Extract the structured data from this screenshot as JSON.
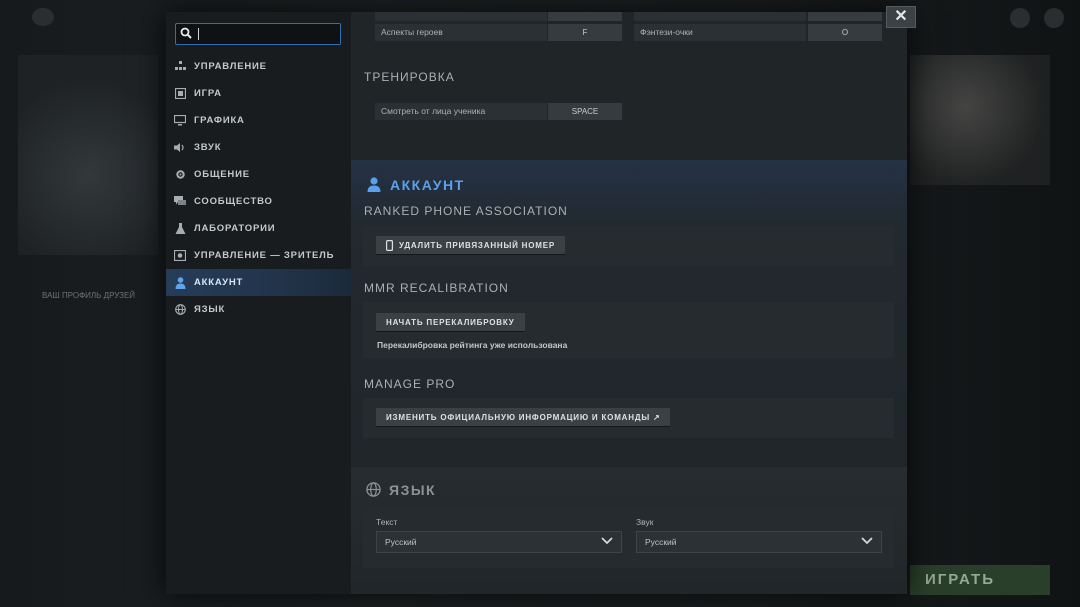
{
  "close_label": "✕",
  "background": {
    "play_label": "ИГРАТЬ",
    "caption": "ВАШ ПРОФИЛЬ ДРУЗЕЙ"
  },
  "sidebar": {
    "search": {
      "value": "",
      "placeholder": ""
    },
    "items": [
      {
        "label": "УПРАВЛЕНИЕ",
        "icon": "grid-icon"
      },
      {
        "label": "ИГРА",
        "icon": "game-icon"
      },
      {
        "label": "ГРАФИКА",
        "icon": "monitor-icon"
      },
      {
        "label": "ЗВУК",
        "icon": "speaker-icon"
      },
      {
        "label": "ОБЩЕНИЕ",
        "icon": "gear-icon"
      },
      {
        "label": "СООБЩЕСТВО",
        "icon": "chat-icon"
      },
      {
        "label": "ЛАБОРАТОРИИ",
        "icon": "flask-icon"
      },
      {
        "label": "УПРАВЛЕНИЕ — ЗРИТЕЛЬ",
        "icon": "camera-icon"
      },
      {
        "label": "АККАУНТ",
        "icon": "user-icon",
        "active": true
      },
      {
        "label": "ЯЗЫК",
        "icon": "globe-icon"
      }
    ]
  },
  "hotkeys": {
    "rows": [
      {
        "left_label": "Аспекты героев",
        "left_key": "F",
        "right_label": "Фэнтези-очки",
        "right_key": "O"
      }
    ]
  },
  "training": {
    "title": "ТРЕНИРОВКА",
    "label": "Смотреть от лица ученика",
    "key": "SPACE"
  },
  "account": {
    "title": "АККАУНТ",
    "phone": {
      "title": "RANKED PHONE ASSOCIATION",
      "button": "УДАЛИТЬ ПРИВЯЗАННЫЙ НОМЕР"
    },
    "mmr": {
      "title": "MMR RECALIBRATION",
      "button": "НАЧАТЬ ПЕРЕКАЛИБРОВКУ",
      "note": "Перекалибровка рейтинга уже использована"
    },
    "pro": {
      "title": "MANAGE PRO",
      "button": "ИЗМЕНИТЬ ОФИЦИАЛЬНУЮ ИНФОРМАЦИЮ И КОМАНДЫ ↗"
    }
  },
  "language": {
    "title": "ЯЗЫК",
    "text_label": "Текст",
    "text_value": "Русский",
    "sound_label": "Звук",
    "sound_value": "Русский"
  },
  "colors": {
    "accent": "#5aa0ea",
    "active_bg": "#263c58"
  }
}
